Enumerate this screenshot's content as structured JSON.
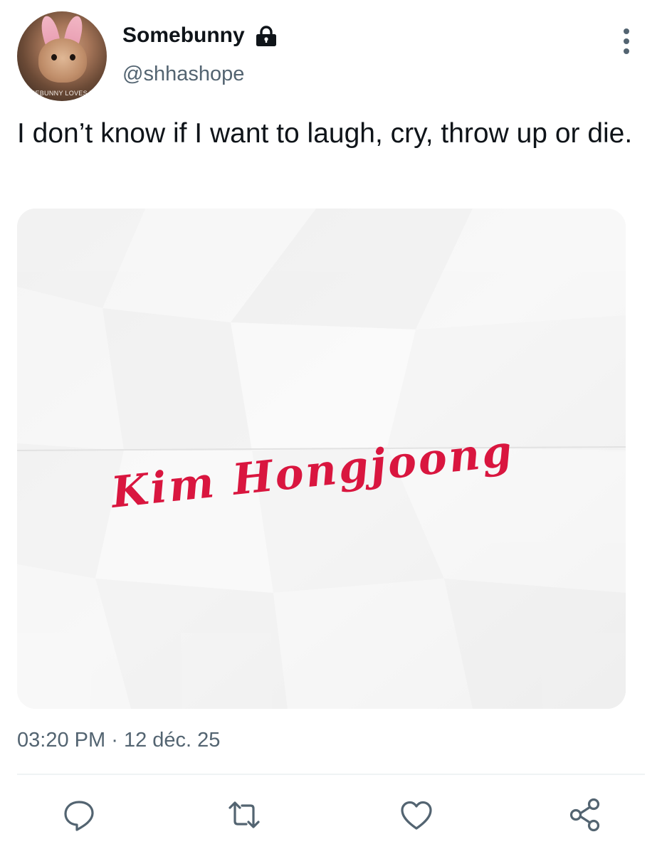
{
  "author": {
    "display_name": "Somebunny",
    "handle": "@shhashope",
    "protected_icon": "lock-icon",
    "avatar_caption": "SOMEBUNNY LOVES YOU"
  },
  "tweet": {
    "text": "I don’t know if I want to laugh, cry, throw up or die.",
    "media": {
      "handwritten_text": "Kim Hongjoong",
      "text_color": "#d9163f"
    },
    "time": "03:20 PM",
    "separator": "·",
    "date": "12 déc. 25"
  },
  "actions": [
    {
      "name": "reply",
      "icon": "comment-icon"
    },
    {
      "name": "retweet",
      "icon": "retweet-icon"
    },
    {
      "name": "like",
      "icon": "heart-icon"
    },
    {
      "name": "share",
      "icon": "share-icon"
    }
  ],
  "colors": {
    "text": "#0f1419",
    "secondary": "#536471",
    "divider": "#eff3f4"
  }
}
